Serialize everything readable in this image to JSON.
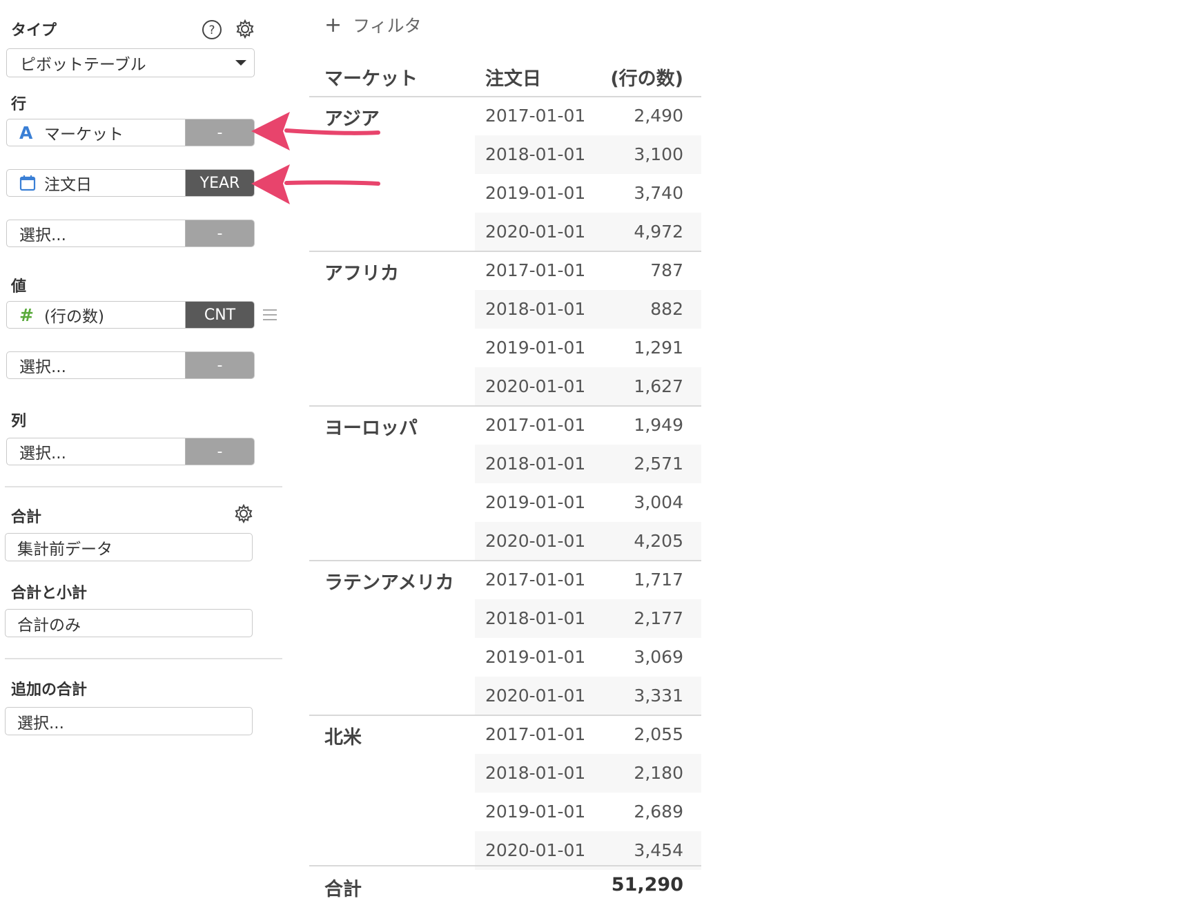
{
  "panel": {
    "type": {
      "label": "タイプ",
      "value": "ピボットテーブル"
    },
    "rows": {
      "label": "行",
      "fields": [
        {
          "name": "マーケット",
          "agg": "-"
        },
        {
          "name": "注文日",
          "agg": "YEAR"
        },
        {
          "name": "選択...",
          "agg": "-"
        }
      ]
    },
    "values": {
      "label": "値",
      "fields": [
        {
          "name": "(行の数)",
          "agg": "CNT"
        },
        {
          "name": "選択...",
          "agg": "-"
        }
      ]
    },
    "columns": {
      "label": "列",
      "fields": [
        {
          "name": "選択...",
          "agg": "-"
        }
      ]
    },
    "total": {
      "label": "合計",
      "value": "集計前データ"
    },
    "total_subtotal": {
      "label": "合計と小計",
      "value": "合計のみ"
    },
    "additional_total": {
      "label": "追加の合計",
      "value": "選択..."
    }
  },
  "filter": {
    "label": "フィルタ"
  },
  "table": {
    "headers": [
      "マーケット",
      "注文日",
      "(行の数)"
    ],
    "groups": [
      {
        "market": "アジア",
        "rows": [
          [
            "2017-01-01",
            "2,490"
          ],
          [
            "2018-01-01",
            "3,100"
          ],
          [
            "2019-01-01",
            "3,740"
          ],
          [
            "2020-01-01",
            "4,972"
          ]
        ]
      },
      {
        "market": "アフリカ",
        "rows": [
          [
            "2017-01-01",
            "787"
          ],
          [
            "2018-01-01",
            "882"
          ],
          [
            "2019-01-01",
            "1,291"
          ],
          [
            "2020-01-01",
            "1,627"
          ]
        ]
      },
      {
        "market": "ヨーロッパ",
        "rows": [
          [
            "2017-01-01",
            "1,949"
          ],
          [
            "2018-01-01",
            "2,571"
          ],
          [
            "2019-01-01",
            "3,004"
          ],
          [
            "2020-01-01",
            "4,205"
          ]
        ]
      },
      {
        "market": "ラテンアメリカ",
        "rows": [
          [
            "2017-01-01",
            "1,717"
          ],
          [
            "2018-01-01",
            "2,177"
          ],
          [
            "2019-01-01",
            "3,069"
          ],
          [
            "2020-01-01",
            "3,331"
          ]
        ]
      },
      {
        "market": "北米",
        "rows": [
          [
            "2017-01-01",
            "2,055"
          ],
          [
            "2018-01-01",
            "2,180"
          ],
          [
            "2019-01-01",
            "2,689"
          ],
          [
            "2020-01-01",
            "3,454"
          ]
        ]
      }
    ],
    "total_label": "合計",
    "total_value": "51,290"
  },
  "colors": {
    "arrow": "#e8446c",
    "agg_dark": "#595959",
    "agg_light": "#a3a3a3",
    "text_icon_blue": "#3a7fd5",
    "number_icon_green": "#5aaa3c"
  }
}
